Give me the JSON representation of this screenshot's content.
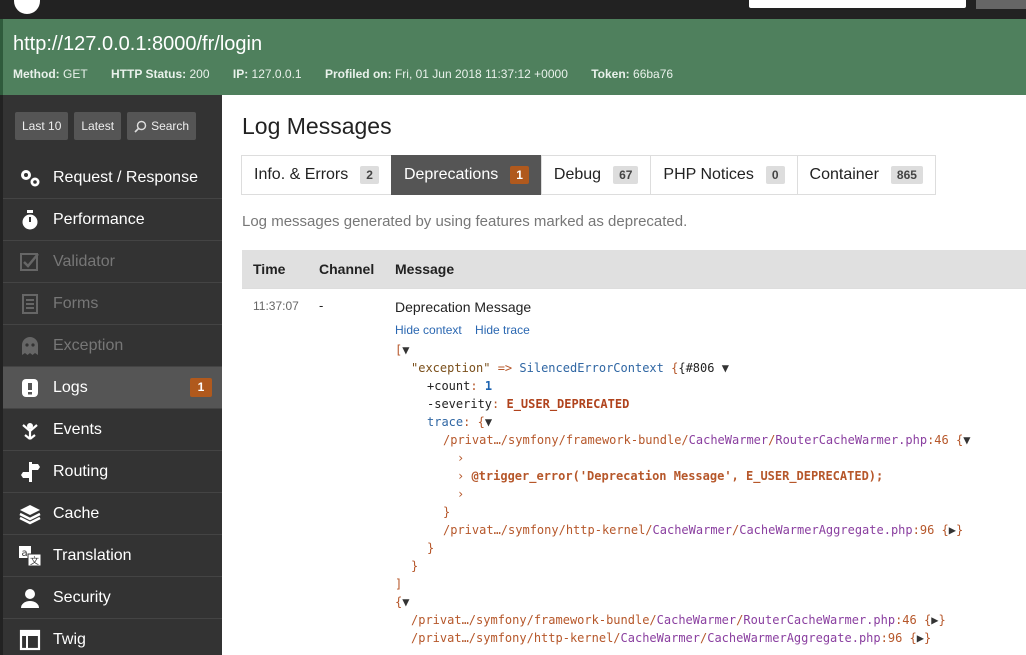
{
  "summary": {
    "url": "http://127.0.0.1:8000/fr/login",
    "method_label": "Method:",
    "method": "GET",
    "status_label": "HTTP Status:",
    "status": "200",
    "ip_label": "IP:",
    "ip": "127.0.0.1",
    "profiled_label": "Profiled on:",
    "profiled": "Fri, 01 Jun 2018 11:37:12 +0000",
    "token_label": "Token:",
    "token": "66ba76"
  },
  "sidebar": {
    "buttons": [
      "Last 10",
      "Latest",
      "Search"
    ],
    "items": [
      {
        "label": "Request / Response",
        "icon": "gears-icon",
        "disabled": false
      },
      {
        "label": "Performance",
        "icon": "stopwatch-icon",
        "disabled": false
      },
      {
        "label": "Validator",
        "icon": "checkbox-icon",
        "disabled": true
      },
      {
        "label": "Forms",
        "icon": "form-icon",
        "disabled": true
      },
      {
        "label": "Exception",
        "icon": "ghost-icon",
        "disabled": true
      },
      {
        "label": "Logs",
        "icon": "logs-icon",
        "disabled": false,
        "active": true,
        "badge": "1"
      },
      {
        "label": "Events",
        "icon": "events-icon",
        "disabled": false
      },
      {
        "label": "Routing",
        "icon": "signpost-icon",
        "disabled": false
      },
      {
        "label": "Cache",
        "icon": "layers-icon",
        "disabled": false
      },
      {
        "label": "Translation",
        "icon": "translation-icon",
        "disabled": false
      },
      {
        "label": "Security",
        "icon": "user-icon",
        "disabled": false
      },
      {
        "label": "Twig",
        "icon": "twig-icon",
        "disabled": false
      }
    ]
  },
  "main": {
    "title": "Log Messages",
    "tabs": [
      {
        "label": "Info. & Errors",
        "count": "2"
      },
      {
        "label": "Deprecations",
        "count": "1",
        "active": true
      },
      {
        "label": "Debug",
        "count": "67"
      },
      {
        "label": "PHP Notices",
        "count": "0"
      },
      {
        "label": "Container",
        "count": "865"
      }
    ],
    "description": "Log messages generated by using features marked as deprecated.",
    "columns": [
      "Time",
      "Channel",
      "Message"
    ],
    "row": {
      "time": "11:37:07",
      "channel": "-",
      "message": "Deprecation Message",
      "link1": "Hide context",
      "link2": "Hide trace"
    },
    "dump": {
      "exception_key": "\"exception\"",
      "arrow": " => ",
      "exception_class": "SilencedErrorContext",
      "exception_id": "{#806",
      "count_key": "+count",
      "count_val": "1",
      "severity_key": "-severity",
      "severity_val": "E_USER_DEPRECATED",
      "trace_key": "trace",
      "trace_open": "{",
      "path1_prefix": "/privat…/symfony/framework-bundle/",
      "path1_cls": "CacheWarmer",
      "path1_sep": "/",
      "path1_file": "RouterCacheWarmer.php",
      "path1_line": ":46",
      "code_line": "@trigger_error('Deprecation Message', E_USER_DEPRECATED);",
      "path2_prefix": "/privat…/symfony/http-kernel/",
      "path2_cls": "CacheWarmer",
      "path2_sep": "/",
      "path2_file": "CacheWarmerAggregate.php",
      "path2_line": ":96",
      "path3_prefix": "/privat…/symfony/framework-bundle/",
      "path3_cls": "CacheWarmer",
      "path3_sep": "/",
      "path3_file": "RouterCacheWarmer.php",
      "path3_line": ":46",
      "path4_prefix": "/privat…/symfony/http-kernel/",
      "path4_cls": "CacheWarmer",
      "path4_sep": "/",
      "path4_file": "CacheWarmerAggregate.php",
      "path4_line": ":96"
    }
  },
  "colors": {
    "green": "#4f805d",
    "sidebar": "#333333",
    "badge": "#b0591d"
  }
}
